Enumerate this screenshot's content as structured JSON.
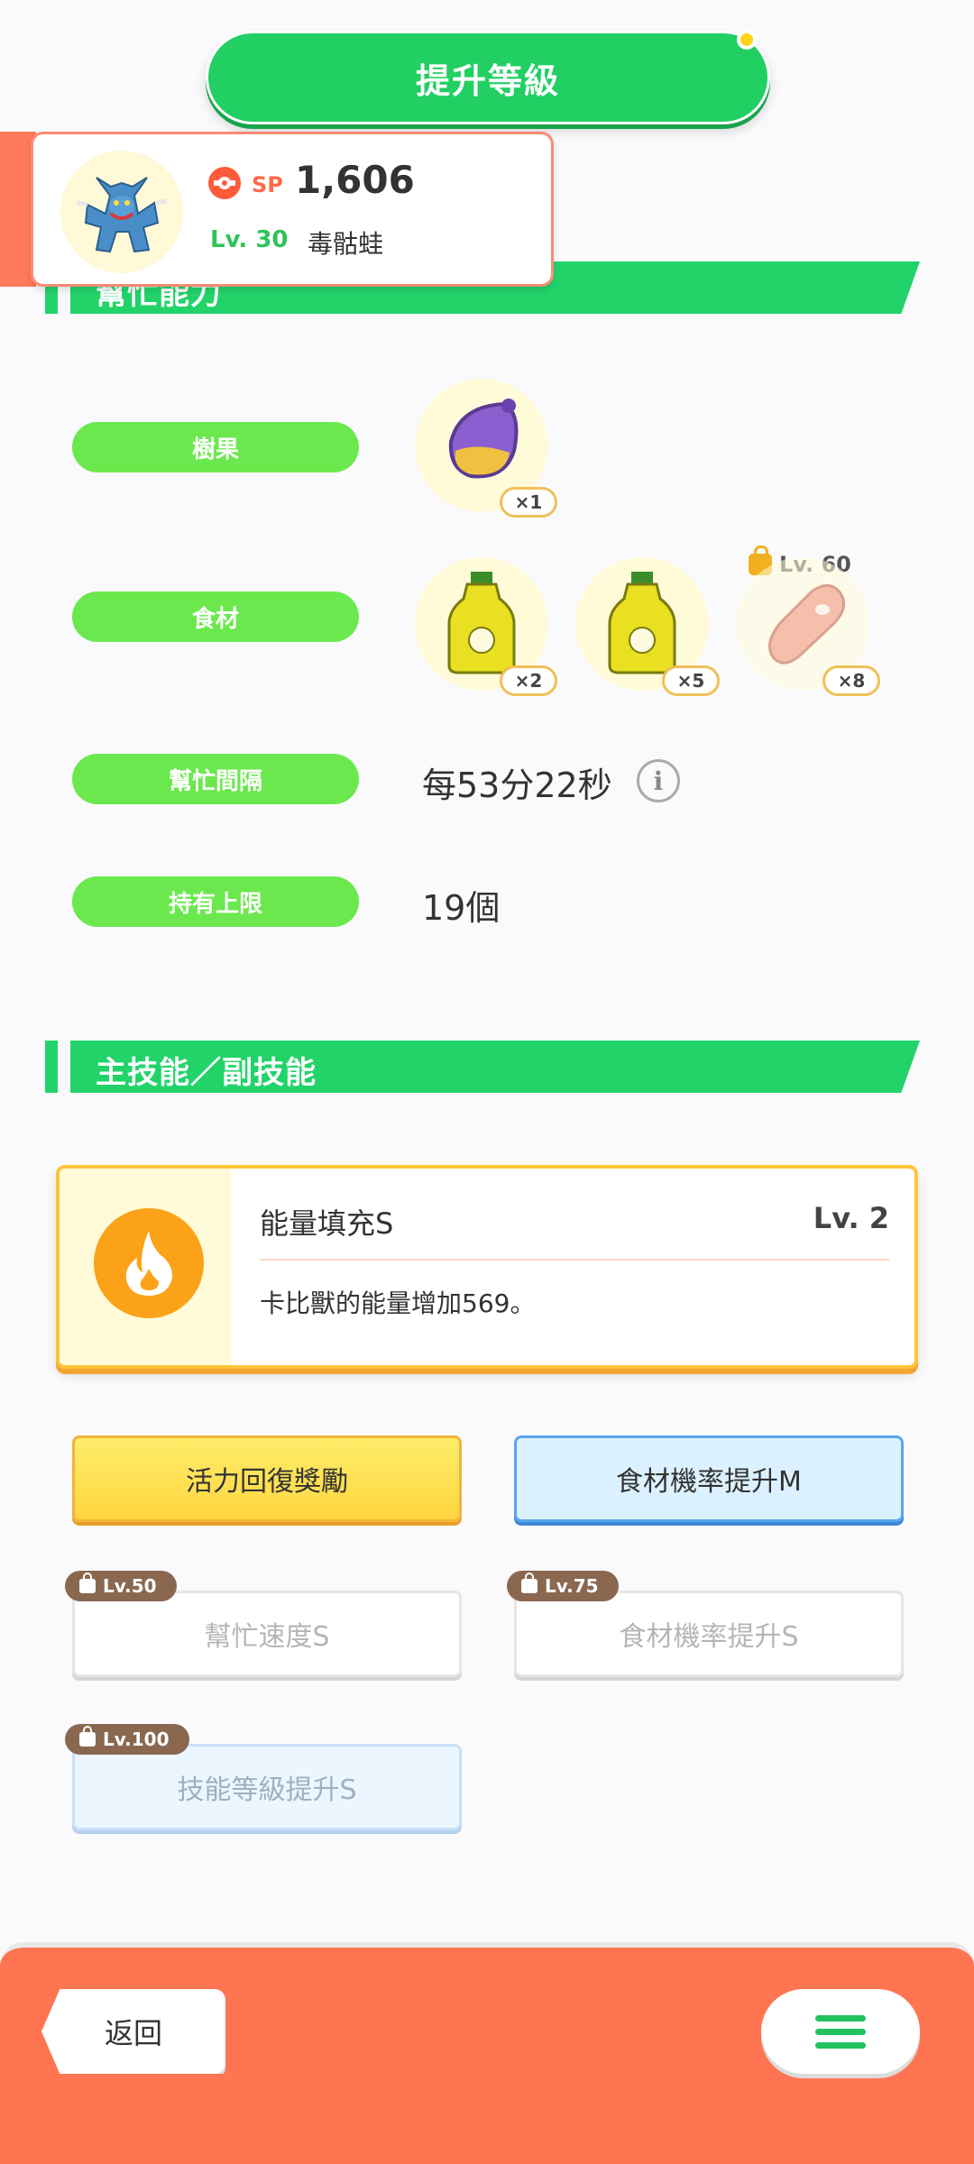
{
  "header": {
    "level_up_label": "提升等級"
  },
  "pokemon": {
    "sp_label": "SP",
    "sp_value": "1,606",
    "level": "Lv. 30",
    "name": "毒骷蛙"
  },
  "help_section": {
    "title": "幫忙能力",
    "berry_label": "樹果",
    "berry_count": "×1",
    "ingredients_label": "食材",
    "ingredients": [
      {
        "count": "×2"
      },
      {
        "count": "×5"
      },
      {
        "count": "×8",
        "lock_level": "Lv. 60"
      }
    ],
    "interval_label": "幫忙間隔",
    "interval_value": "每53分22秒",
    "info_symbol": "i",
    "capacity_label": "持有上限",
    "capacity_value": "19個"
  },
  "skill_section": {
    "title": "主技能／副技能",
    "main_skill": {
      "name": "能量填充S",
      "level": "Lv. 2",
      "description": "卡比獸的能量增加569。"
    },
    "sub_skills": [
      {
        "label": "活力回復獎勵"
      },
      {
        "label": "食材機率提升M"
      },
      {
        "label": "幫忙速度S",
        "lock": "Lv.50"
      },
      {
        "label": "食材機率提升S",
        "lock": "Lv.75"
      },
      {
        "label": "技能等級提升S",
        "lock": "Lv.100"
      }
    ]
  },
  "footer": {
    "back_label": "返回"
  },
  "colors": {
    "green": "#21cf62",
    "pill_green": "#6be84e",
    "orange": "#ff7552",
    "gold": "#ffc53a",
    "blue": "#58a7ee"
  },
  "icons": [
    "pokeball-icon",
    "berry-icon",
    "oil-bottle-icon",
    "sausage-icon",
    "lock-icon",
    "info-icon",
    "flame-icon",
    "menu-icon"
  ]
}
